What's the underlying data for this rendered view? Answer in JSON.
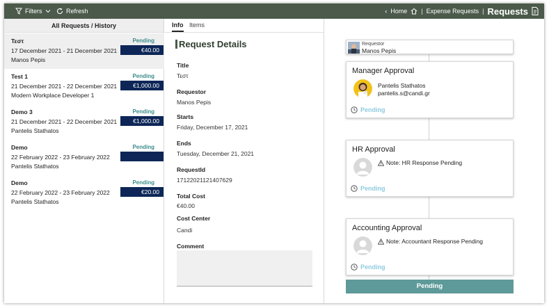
{
  "topbar": {
    "filters_label": "Filters",
    "refresh_label": "Refresh",
    "breadcrumb_home": "Home",
    "breadcrumb_expense": "Expense Requests",
    "separator": "|",
    "title": "Requests"
  },
  "left": {
    "header": "All Requests / History",
    "requests": [
      {
        "title": "Τεστ",
        "dates": "17  December 2021 - 21  December 2021",
        "person": "Manos Pepis",
        "status": "Pending",
        "amount": "€40.00"
      },
      {
        "title": "Test 1",
        "dates": "21  December 2021 - 22  December 2021",
        "person": "Modern Workplace Developer 1",
        "status": "Pending",
        "amount": "€1,000.00"
      },
      {
        "title": "Demo 3",
        "dates": "21  December 2021 - 22  December 2021",
        "person": "Pantelis Stathatos",
        "status": "Pending",
        "amount": "€1,000.00"
      },
      {
        "title": "Demo",
        "dates": "22  February 2022 - 23  February 2022",
        "person": "Pantelis Stathatos",
        "status": "Pending",
        "amount": ""
      },
      {
        "title": "Demo",
        "dates": "22  February 2022 - 23  February 2022",
        "person": "Pantelis Stathatos",
        "status": "Pending",
        "amount": "€20.00"
      }
    ]
  },
  "middle": {
    "tabs": [
      "Info",
      "Items"
    ],
    "section_title": "Request Details",
    "fields": {
      "title_label": "Title",
      "title_value": "Τεστ",
      "requestor_label": "Requestor",
      "requestor_value": "Manos Pepis",
      "starts_label": "Starts",
      "starts_value": "Friday, December 17, 2021",
      "ends_label": "Ends",
      "ends_value": "Tuesday, December 21, 2021",
      "requestid_label": "RequestId",
      "requestid_value": "17122021121407629",
      "totalcost_label": "Total Cost",
      "totalcost_value": "€40.00",
      "costcenter_label": "Cost Center",
      "costcenter_value": "Candi",
      "comment_label": "Comment"
    }
  },
  "right": {
    "requestor_label": "Requestor",
    "requestor_name": "Manos Pepis",
    "approvals": [
      {
        "title": "Manager Approval",
        "name": "Pantelis Stathatos",
        "email": "pantelis.s@candi.gr",
        "status": "Pending"
      },
      {
        "title": "HR Approval",
        "note": "Note: HR Response Pending",
        "status": "Pending"
      },
      {
        "title": "Accounting Approval",
        "note": "Note: Accountant Response Pending",
        "status": "Pending"
      }
    ],
    "bottom_status": "Pending"
  },
  "colors": {
    "topbar": "#4b5a4a",
    "amount_badge": "#0d2657",
    "status_text": "#3c8c8c",
    "pending_light": "#8ecbe0",
    "bottom_button": "#5f9a9a"
  }
}
